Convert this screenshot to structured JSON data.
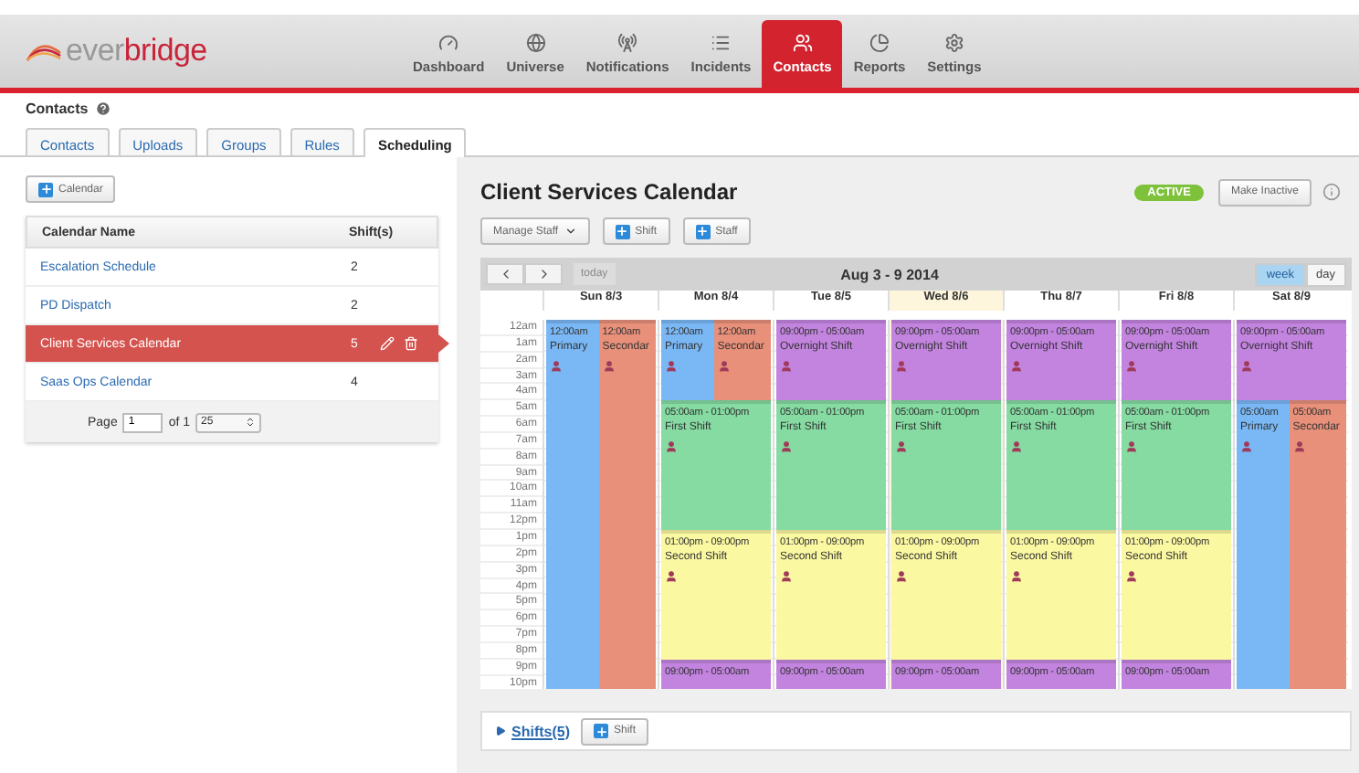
{
  "logo": {
    "light": "ever",
    "strong": "bridge"
  },
  "nav": [
    {
      "label": "Dashboard",
      "selected": false
    },
    {
      "label": "Universe",
      "selected": false
    },
    {
      "label": "Notifications",
      "selected": false
    },
    {
      "label": "Incidents",
      "selected": false
    },
    {
      "label": "Contacts",
      "selected": true
    },
    {
      "label": "Reports",
      "selected": false
    },
    {
      "label": "Settings",
      "selected": false
    }
  ],
  "page_title": "Contacts",
  "tabs": [
    {
      "label": "Contacts",
      "selected": false
    },
    {
      "label": "Uploads",
      "selected": false
    },
    {
      "label": "Groups",
      "selected": false
    },
    {
      "label": "Rules",
      "selected": false
    },
    {
      "label": "Scheduling",
      "selected": true
    }
  ],
  "calendars": {
    "add_button": "Calendar",
    "columns": [
      "Calendar Name",
      "Shift(s)"
    ],
    "rows": [
      {
        "name": "Escalation Schedule",
        "shifts": "2",
        "selected": false
      },
      {
        "name": "PD Dispatch",
        "shifts": "2",
        "selected": false
      },
      {
        "name": "Client Services Calendar",
        "shifts": "5",
        "selected": true
      },
      {
        "name": "Saas Ops Calendar",
        "shifts": "4",
        "selected": false
      }
    ],
    "pager": {
      "label": "Page",
      "page": "1",
      "of": "of 1",
      "size": "25"
    }
  },
  "calendar": {
    "title": "Client Services Calendar",
    "status": "ACTIVE",
    "status_button": "Make Inactive",
    "toolbar": {
      "manage": "Manage Staff",
      "add_shift": "Shift",
      "add_staff": "Staff"
    },
    "range": "Aug 3 - 9 2014",
    "today": "today",
    "views": [
      {
        "label": "week",
        "selected": true
      },
      {
        "label": "day",
        "selected": false
      }
    ],
    "hours": [
      "12am",
      "1am",
      "2am",
      "3am",
      "4am",
      "5am",
      "6am",
      "7am",
      "8am",
      "9am",
      "10am",
      "11am",
      "12pm",
      "1pm",
      "2pm",
      "3pm",
      "4pm",
      "5pm",
      "6pm",
      "7pm",
      "8pm",
      "9pm",
      "10pm"
    ],
    "days": [
      {
        "label": "Sun 8/3",
        "today": false,
        "events": [
          {
            "kind": "full-left",
            "color": "#7ab8f5",
            "time": "12:00am",
            "title": "Primary"
          },
          {
            "kind": "full-right",
            "color": "#e8907a",
            "time": "12:00am",
            "title": "Secondar"
          }
        ]
      },
      {
        "label": "Mon 8/4",
        "today": false,
        "events": [
          {
            "kind": "early-left",
            "color": "#7ab8f5",
            "time": "12:00am",
            "title": "Primary"
          },
          {
            "kind": "early-right",
            "color": "#e8907a",
            "time": "12:00am",
            "title": "Secondar"
          },
          {
            "kind": "day",
            "color": "#86dba2",
            "time": "05:00am - 01:00pm",
            "title": "First Shift"
          },
          {
            "kind": "evening",
            "color": "#fbf8a2",
            "time": "01:00pm - 09:00pm",
            "title": "Second Shift"
          },
          {
            "kind": "night",
            "color": "#c384e0",
            "time": "09:00pm - 05:00am"
          }
        ]
      },
      {
        "label": "Tue 8/5",
        "today": false,
        "events": [
          {
            "kind": "early",
            "color": "#c384e0",
            "time": "09:00pm - 05:00am",
            "title": "Overnight Shift"
          },
          {
            "kind": "day",
            "color": "#86dba2",
            "time": "05:00am - 01:00pm",
            "title": "First Shift"
          },
          {
            "kind": "evening",
            "color": "#fbf8a2",
            "time": "01:00pm - 09:00pm",
            "title": "Second Shift"
          },
          {
            "kind": "night",
            "color": "#c384e0",
            "time": "09:00pm - 05:00am"
          }
        ]
      },
      {
        "label": "Wed 8/6",
        "today": true,
        "events": [
          {
            "kind": "early",
            "color": "#c384e0",
            "time": "09:00pm - 05:00am",
            "title": "Overnight Shift"
          },
          {
            "kind": "day",
            "color": "#86dba2",
            "time": "05:00am - 01:00pm",
            "title": "First Shift"
          },
          {
            "kind": "evening",
            "color": "#fbf8a2",
            "time": "01:00pm - 09:00pm",
            "title": "Second Shift"
          },
          {
            "kind": "night",
            "color": "#c384e0",
            "time": "09:00pm - 05:00am"
          }
        ]
      },
      {
        "label": "Thu 8/7",
        "today": false,
        "events": [
          {
            "kind": "early",
            "color": "#c384e0",
            "time": "09:00pm - 05:00am",
            "title": "Overnight Shift"
          },
          {
            "kind": "day",
            "color": "#86dba2",
            "time": "05:00am - 01:00pm",
            "title": "First Shift"
          },
          {
            "kind": "evening",
            "color": "#fbf8a2",
            "time": "01:00pm - 09:00pm",
            "title": "Second Shift"
          },
          {
            "kind": "night",
            "color": "#c384e0",
            "time": "09:00pm - 05:00am"
          }
        ]
      },
      {
        "label": "Fri 8/8",
        "today": false,
        "events": [
          {
            "kind": "early",
            "color": "#c384e0",
            "time": "09:00pm - 05:00am",
            "title": "Overnight Shift"
          },
          {
            "kind": "day",
            "color": "#86dba2",
            "time": "05:00am - 01:00pm",
            "title": "First Shift"
          },
          {
            "kind": "evening",
            "color": "#fbf8a2",
            "time": "01:00pm - 09:00pm",
            "title": "Second Shift"
          },
          {
            "kind": "night",
            "color": "#c384e0",
            "time": "09:00pm - 05:00am"
          }
        ]
      },
      {
        "label": "Sat 8/9",
        "today": false,
        "events": [
          {
            "kind": "early",
            "color": "#c384e0",
            "time": "09:00pm - 05:00am",
            "title": "Overnight Shift"
          },
          {
            "kind": "late-left",
            "color": "#7ab8f5",
            "time": "05:00am",
            "title": "Primary"
          },
          {
            "kind": "late-right",
            "color": "#e8907a",
            "time": "05:00am",
            "title": "Secondar"
          }
        ]
      }
    ]
  },
  "shifts_footer": {
    "link": "Shifts(5)",
    "add_shift": "Shift"
  }
}
